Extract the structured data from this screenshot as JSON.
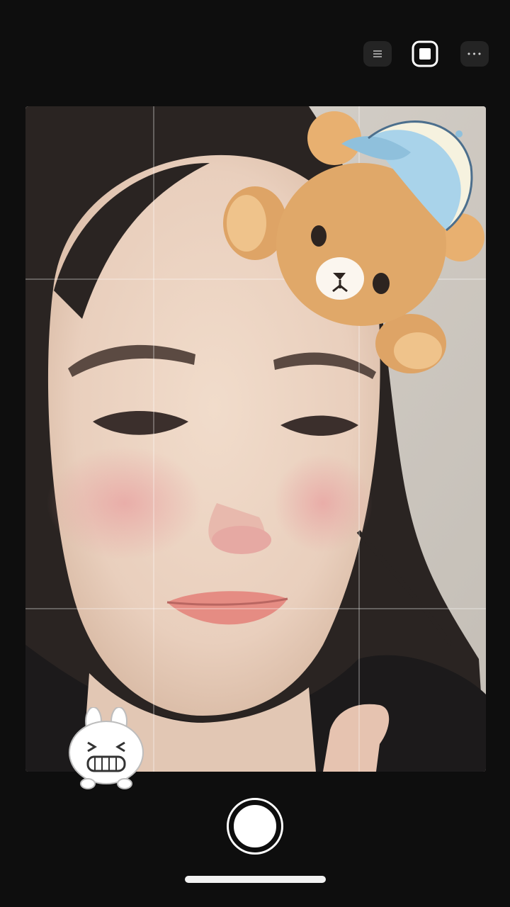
{
  "toolbar": {
    "menu_icon": "hamburger-icon",
    "frame_icon": "square-frame-icon",
    "more_icon": "more-dots-icon",
    "more_glyph": "•••"
  },
  "viewfinder": {
    "grid_visible": true,
    "stickers": [
      "teddy-bear-with-cap",
      "grinning-bunny"
    ]
  },
  "controls": {
    "shutter_icon": "shutter-icon"
  },
  "colors": {
    "background": "#0e0e0e",
    "bear_fur": "#e0a869",
    "cap_blue": "#a9d3ea",
    "shutter": "#ffffff"
  }
}
